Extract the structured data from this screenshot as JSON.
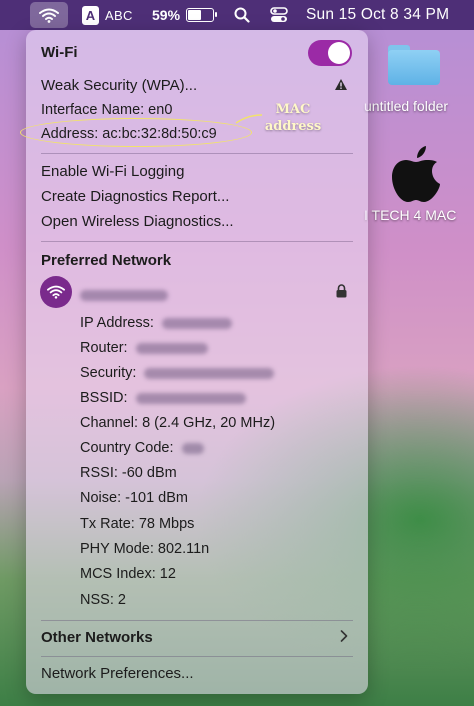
{
  "menubar": {
    "input_source_badge": "A",
    "input_source_label": "ABC",
    "battery_percent": "59%",
    "battery_level": 0.59,
    "clock": "Sun 15 Oct  8 34 PM",
    "icons": [
      "wifi-icon",
      "search-icon",
      "control-center-icon"
    ]
  },
  "desktop": {
    "folder_label": "untitled folder",
    "apple_label": "I TECH 4 MAC"
  },
  "wifi_panel": {
    "title": "Wi-Fi",
    "toggle_on": true,
    "security_warning": "Weak Security (WPA)...",
    "interface_name": "Interface Name: en0",
    "address": "Address: ac:bc:32:8d:50:c9",
    "actions": [
      "Enable Wi-Fi Logging",
      "Create Diagnostics Report...",
      "Open Wireless Diagnostics..."
    ],
    "preferred_header": "Preferred Network",
    "details": {
      "ip_address_label": "IP Address:",
      "router_label": "Router:",
      "security_label": "Security:",
      "bssid_label": "BSSID:",
      "channel": "Channel: 8 (2.4 GHz, 20 MHz)",
      "country_code_label": "Country Code:",
      "rssi": "RSSI: -60 dBm",
      "noise": "Noise: -101 dBm",
      "tx_rate": "Tx Rate: 78 Mbps",
      "phy_mode": "PHY Mode: 802.11n",
      "mcs_index": "MCS Index: 12",
      "nss": "NSS: 2"
    },
    "other_networks": "Other Networks",
    "network_preferences": "Network Preferences..."
  },
  "annotation": {
    "text": "MAC address",
    "color": "#f2e36a"
  },
  "colors": {
    "menubar": "#4e2f77",
    "toggle": "#9b2aa6",
    "network_icon_bg": "#7a2a8c"
  }
}
